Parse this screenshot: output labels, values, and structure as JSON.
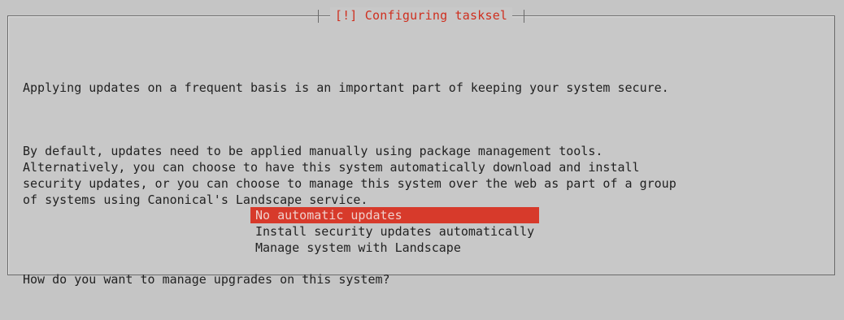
{
  "dialog": {
    "title": "[!] Configuring tasksel",
    "intro": "Applying updates on a frequent basis is an important part of keeping your system secure.",
    "details": "By default, updates need to be applied manually using package management tools.\nAlternatively, you can choose to have this system automatically download and install\nsecurity updates, or you can choose to manage this system over the web as part of a group\nof systems using Canonical's Landscape service.",
    "question": "How do you want to manage upgrades on this system?",
    "options": [
      {
        "label": "No automatic updates",
        "selected": true
      },
      {
        "label": "Install security updates automatically",
        "selected": false
      },
      {
        "label": "Manage system with Landscape",
        "selected": false
      }
    ]
  },
  "colors": {
    "background": "#c5c5c5",
    "title_text": "#cf2f1f",
    "selected_bg": "#d73a2b",
    "body_text": "#222222"
  }
}
